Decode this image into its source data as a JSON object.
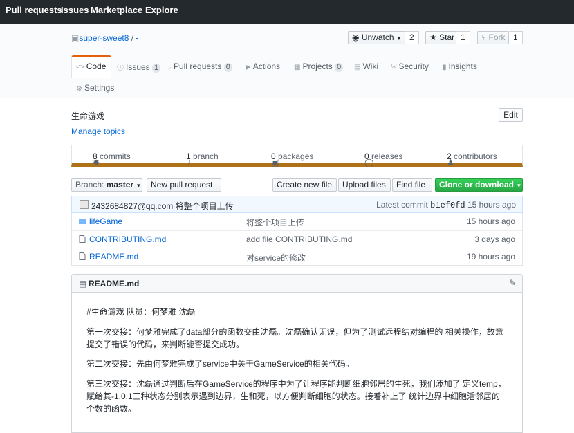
{
  "topnav": {
    "pull_requests": "Pull requests",
    "issues": "Issues",
    "marketplace": "Marketplace",
    "explore": "Explore"
  },
  "repo": {
    "owner": "super-sweet8",
    "separator": " / ",
    "name": "-"
  },
  "actions": {
    "watch_label": "Unwatch",
    "watch_count": "2",
    "star_label": "Star",
    "star_count": "1",
    "fork_label": "Fork",
    "fork_count": "1"
  },
  "tabs": {
    "code": "Code",
    "issues": "Issues",
    "issues_count": "1",
    "pulls": "Pull requests",
    "pulls_count": "0",
    "actions": "Actions",
    "projects": "Projects",
    "projects_count": "0",
    "wiki": "Wiki",
    "security": "Security",
    "insights": "Insights",
    "settings": "Settings"
  },
  "description": "生命游戏",
  "manage_topics": "Manage topics",
  "edit_label": "Edit",
  "summary": {
    "commits_num": "8",
    "commits_label": "commits",
    "branch_num": "1",
    "branch_label": "branch",
    "packages_num": "0",
    "packages_label": "packages",
    "releases_num": "0",
    "releases_label": "releases",
    "contributors_num": "2",
    "contributors_label": "contributors"
  },
  "language_color": "#b07219",
  "filebar": {
    "branch_prefix": "Branch:",
    "branch_name": "master",
    "new_pr": "New pull request",
    "create_file": "Create new file",
    "upload_files": "Upload files",
    "find_file": "Find file",
    "clone": "Clone or download"
  },
  "commit": {
    "author": "2432684827@qq.com",
    "message": "将整个项目上传",
    "latest_label": "Latest commit",
    "sha": "b1ef0fd",
    "age": "15 hours ago"
  },
  "files": [
    {
      "name": "lifeGame",
      "type": "dir",
      "message": "将整个项目上传",
      "age": "15 hours ago"
    },
    {
      "name": "CONTRIBUTING.md",
      "type": "file",
      "message": "add file CONTRIBUTING.md",
      "age": "3 days ago"
    },
    {
      "name": "README.md",
      "type": "file",
      "message": "对service的修改",
      "age": "19 hours ago"
    }
  ],
  "readme": {
    "title": "README.md",
    "p1": "#生命游戏 队员：何梦雅 沈磊",
    "p2": "第一次交接：何梦雅完成了data部分的函数交由沈磊。沈磊确认无误，但为了测试远程结对编程的 相关操作，故意提交了错误的代码，来判断能否提交成功。",
    "p3": "第二次交接：先由何梦雅完成了service中关于GameService的相关代码。",
    "p4": "第三次交接：沈磊通过判断后在GameService的程序中为了让程序能判断细胞邻居的生死，我们添加了 定义temp，赋给其-1,0,1三种状态分别表示遇到边界，生和死，以方便判断细胞的状态。接着补上了 统计边界中细胞活邻居的个数的函数。"
  }
}
